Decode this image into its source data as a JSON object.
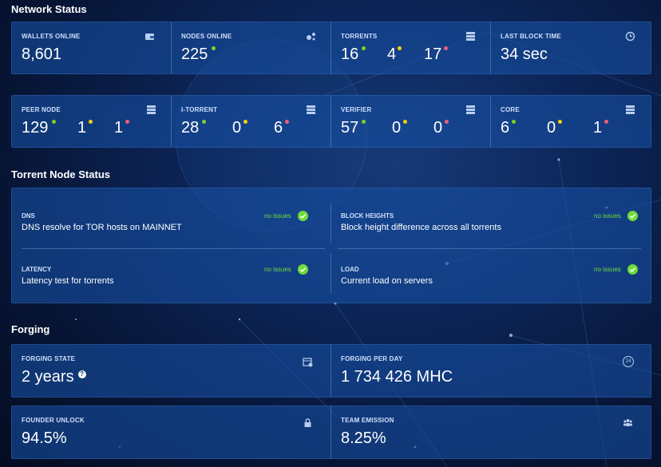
{
  "network": {
    "title": "Network Status",
    "wallets": {
      "label": "WALLETS ONLINE",
      "value": "8,601"
    },
    "nodes": {
      "label": "NODES ONLINE",
      "value": "225"
    },
    "torrents": {
      "label": "TORRENTS",
      "green": "16",
      "yellow": "4",
      "red": "17"
    },
    "last_block": {
      "label": "LAST BLOCK TIME",
      "value": "34 sec"
    },
    "peer": {
      "label": "PEER NODE",
      "green": "129",
      "yellow": "1",
      "red": "1"
    },
    "itorrent": {
      "label": "I-TORRENT",
      "green": "28",
      "yellow": "0",
      "red": "6"
    },
    "verifier": {
      "label": "VERIFIER",
      "green": "57",
      "yellow": "0",
      "red": "0"
    },
    "core": {
      "label": "CORE",
      "green": "6",
      "yellow": "0",
      "red": "1"
    }
  },
  "torrent_status": {
    "title": "Torrent Node Status",
    "no_issues": "no issues",
    "dns": {
      "label": "DNS",
      "desc": "DNS resolve for TOR hosts on MAINNET"
    },
    "block_heights": {
      "label": "BLOCK HEIGHTS",
      "desc": "Block height difference across all torrents"
    },
    "latency": {
      "label": "LATENCY",
      "desc": "Latency test for torrents"
    },
    "load": {
      "label": "LOAD",
      "desc": "Current load on servers"
    }
  },
  "forging": {
    "title": "Forging",
    "state": {
      "label": "FORGING STATE",
      "value": "2 years",
      "help": "?"
    },
    "per_day": {
      "label": "FORGING PER DAY",
      "value": "1 734 426 MHC",
      "icon_text": "24"
    },
    "founder_unlock": {
      "label": "FOUNDER UNLOCK",
      "value": "94.5%"
    },
    "team_emission": {
      "label": "TEAM EMISSION",
      "value": "8.25%"
    }
  },
  "colors": {
    "green": "#7ed321",
    "yellow": "#f5d200",
    "red": "#f0607a",
    "ok": "#6fdc3a",
    "panel": "#164ea0"
  }
}
